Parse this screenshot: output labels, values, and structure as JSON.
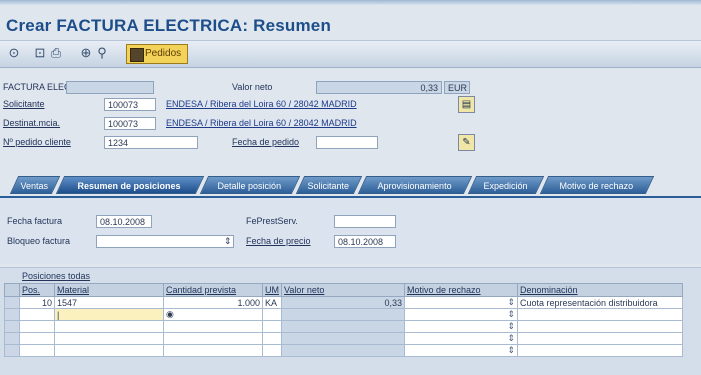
{
  "window": {
    "title": "Crear FACTURA ELECTRICA: Resumen"
  },
  "toolbar": {
    "pedidos_label": "Pedidos"
  },
  "header": {
    "doc_type_label": "FACTURA ELECTRIC",
    "valor_neto_label": "Valor neto",
    "valor_neto_value": "0,33",
    "currency": "EUR",
    "solicitante_label": "Solicitante",
    "solicitante_value": "100073",
    "solicitante_link": "ENDESA / Ribera del Loira 60 / 28042 MADRID",
    "destinatario_label": "Destinat.mcia.",
    "destinatario_value": "100073",
    "destinatario_link": "ENDESA / Ribera del Loira 60 / 28042 MADRID",
    "pedido_cliente_label": "Nº pedido cliente",
    "pedido_cliente_value": "1234",
    "fecha_pedido_label": "Fecha de pedido"
  },
  "tabs": [
    {
      "label": "Ventas"
    },
    {
      "label": "Resumen de posiciones"
    },
    {
      "label": "Detalle posición"
    },
    {
      "label": "Solicitante"
    },
    {
      "label": "Aprovisionamiento"
    },
    {
      "label": "Expedición"
    },
    {
      "label": "Motivo de rechazo"
    }
  ],
  "panel": {
    "fecha_factura_label": "Fecha factura",
    "fecha_factura_value": "08.10.2008",
    "bloqueo_label": "Bloqueo factura",
    "fe_prest_label": "FePrestServ.",
    "fecha_precio_label": "Fecha de precio",
    "fecha_precio_value": "08.10.2008"
  },
  "table": {
    "title": "Posiciones todas",
    "columns": [
      "Pos.",
      "Material",
      "Cantidad prevista",
      "UM",
      "Valor neto",
      "Motivo de rechazo",
      "Denominación"
    ],
    "rows": [
      {
        "pos": "10",
        "material": "1547",
        "cantidad": "1.000",
        "um": "KA",
        "valor": "0,33",
        "motivo": "",
        "denominacion": "Cuota representación distribuidora"
      }
    ]
  },
  "colors": {
    "tab_active": "#1e4f8c",
    "title": "#1d4e8a",
    "pedidos_button": "#f3d25a"
  }
}
